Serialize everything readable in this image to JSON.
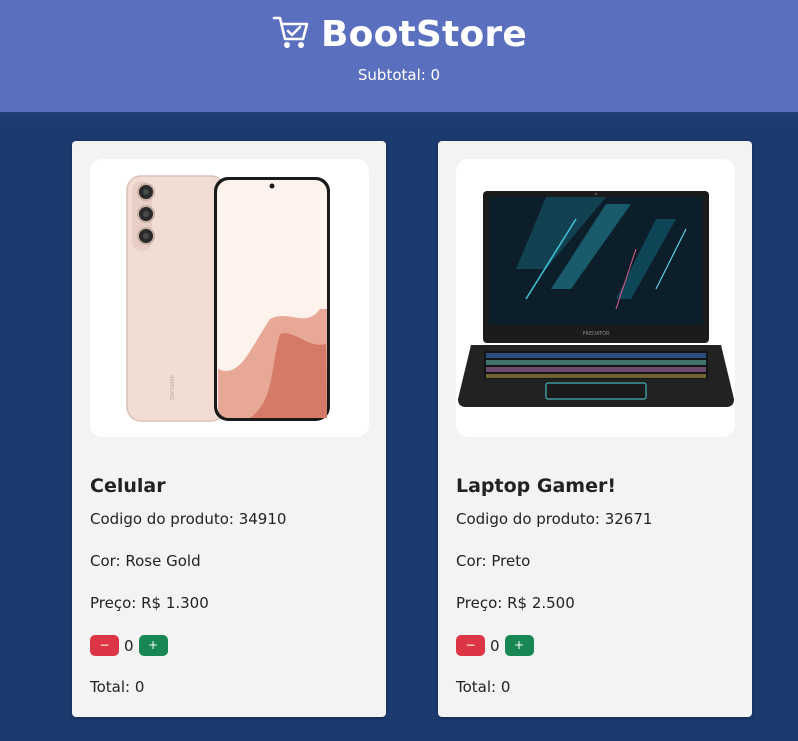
{
  "header": {
    "title": "BootStore",
    "subtotal_label": "Subtotal: 0",
    "icon": "cart-check-icon",
    "background": "#5a6fbd"
  },
  "page": {
    "background": "#1c3a6e"
  },
  "products": [
    {
      "name": "Celular",
      "code": "Codigo do produto: 34910",
      "color": "Cor: Rose Gold",
      "price": "Preço: R$ 1.300",
      "quantity": "0",
      "minus_label": "−",
      "plus_label": "+",
      "total": "Total: 0",
      "image": "smartphone-image"
    },
    {
      "name": "Laptop Gamer!",
      "code": "Codigo do produto: 32671",
      "color": "Cor: Preto",
      "price": "Preço: R$ 2.500",
      "quantity": "0",
      "minus_label": "−",
      "plus_label": "+",
      "total": "Total: 0",
      "image": "laptop-image"
    }
  ],
  "colors": {
    "minus": "#dc3545",
    "plus": "#198754",
    "card": "#f3f3f3"
  }
}
